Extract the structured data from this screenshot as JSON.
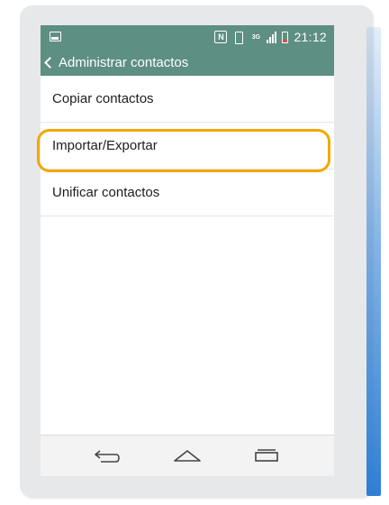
{
  "status_bar": {
    "network_label": "3G",
    "time": "21:12"
  },
  "action_bar": {
    "title": "Administrar contactos"
  },
  "menu": {
    "items": [
      {
        "label": "Copiar contactos"
      },
      {
        "label": "Importar/Exportar"
      },
      {
        "label": "Unificar contactos"
      }
    ]
  },
  "highlighted_item": "Importar/Exportar",
  "icons": {
    "status": [
      "gallery-icon",
      "nfc-icon",
      "vibrate-icon",
      "network-icon",
      "signal-icon",
      "battery-icon"
    ],
    "nav": [
      "back-icon",
      "home-icon",
      "recent-apps-icon"
    ]
  },
  "colors": {
    "header": "#5d8f82",
    "highlight": "#f2a800",
    "battery_low": "#e84a3c"
  }
}
